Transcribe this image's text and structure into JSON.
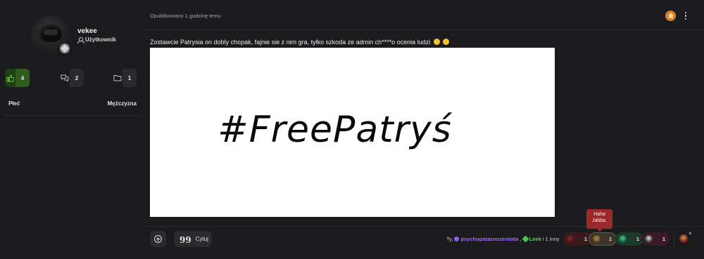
{
  "author": {
    "username": "vekee",
    "role": "Użytkownik",
    "stats": {
      "reputation": "4",
      "posts": "2",
      "files": "1"
    },
    "profile_field": {
      "label": "Płeć",
      "value": "Mężczyzna"
    }
  },
  "post": {
    "meta": "Opublikowano 1 godzinę temu",
    "text": "Zostawcie Patrysia on dobly chopak, fajnie sie z nim gra, tylko szkoda ze admin ch****o ocenia ludzi",
    "image_text": "#FreePatryś"
  },
  "actions": {
    "quote_label": "Cytuj"
  },
  "reactions": {
    "summary_prefix": "Ty,",
    "user_1": "psychopataznozemlata",
    "separator": ",",
    "user_2": "Leek",
    "summary_suffix": "i 1 inny",
    "items": [
      {
        "count": "1"
      },
      {
        "count": "1"
      },
      {
        "count": "1"
      },
      {
        "count": "1"
      }
    ],
    "tooltip_line_1": "Haha",
    "tooltip_line_2": "Jabba.",
    "close": "×"
  },
  "colors": {
    "background": "#1b1b1d",
    "reputation_positive": "#2f5e1c",
    "tooltip": "#9a2a2a",
    "user_1_color": "#9b6cf5",
    "user_2_color": "#5ad06a"
  }
}
